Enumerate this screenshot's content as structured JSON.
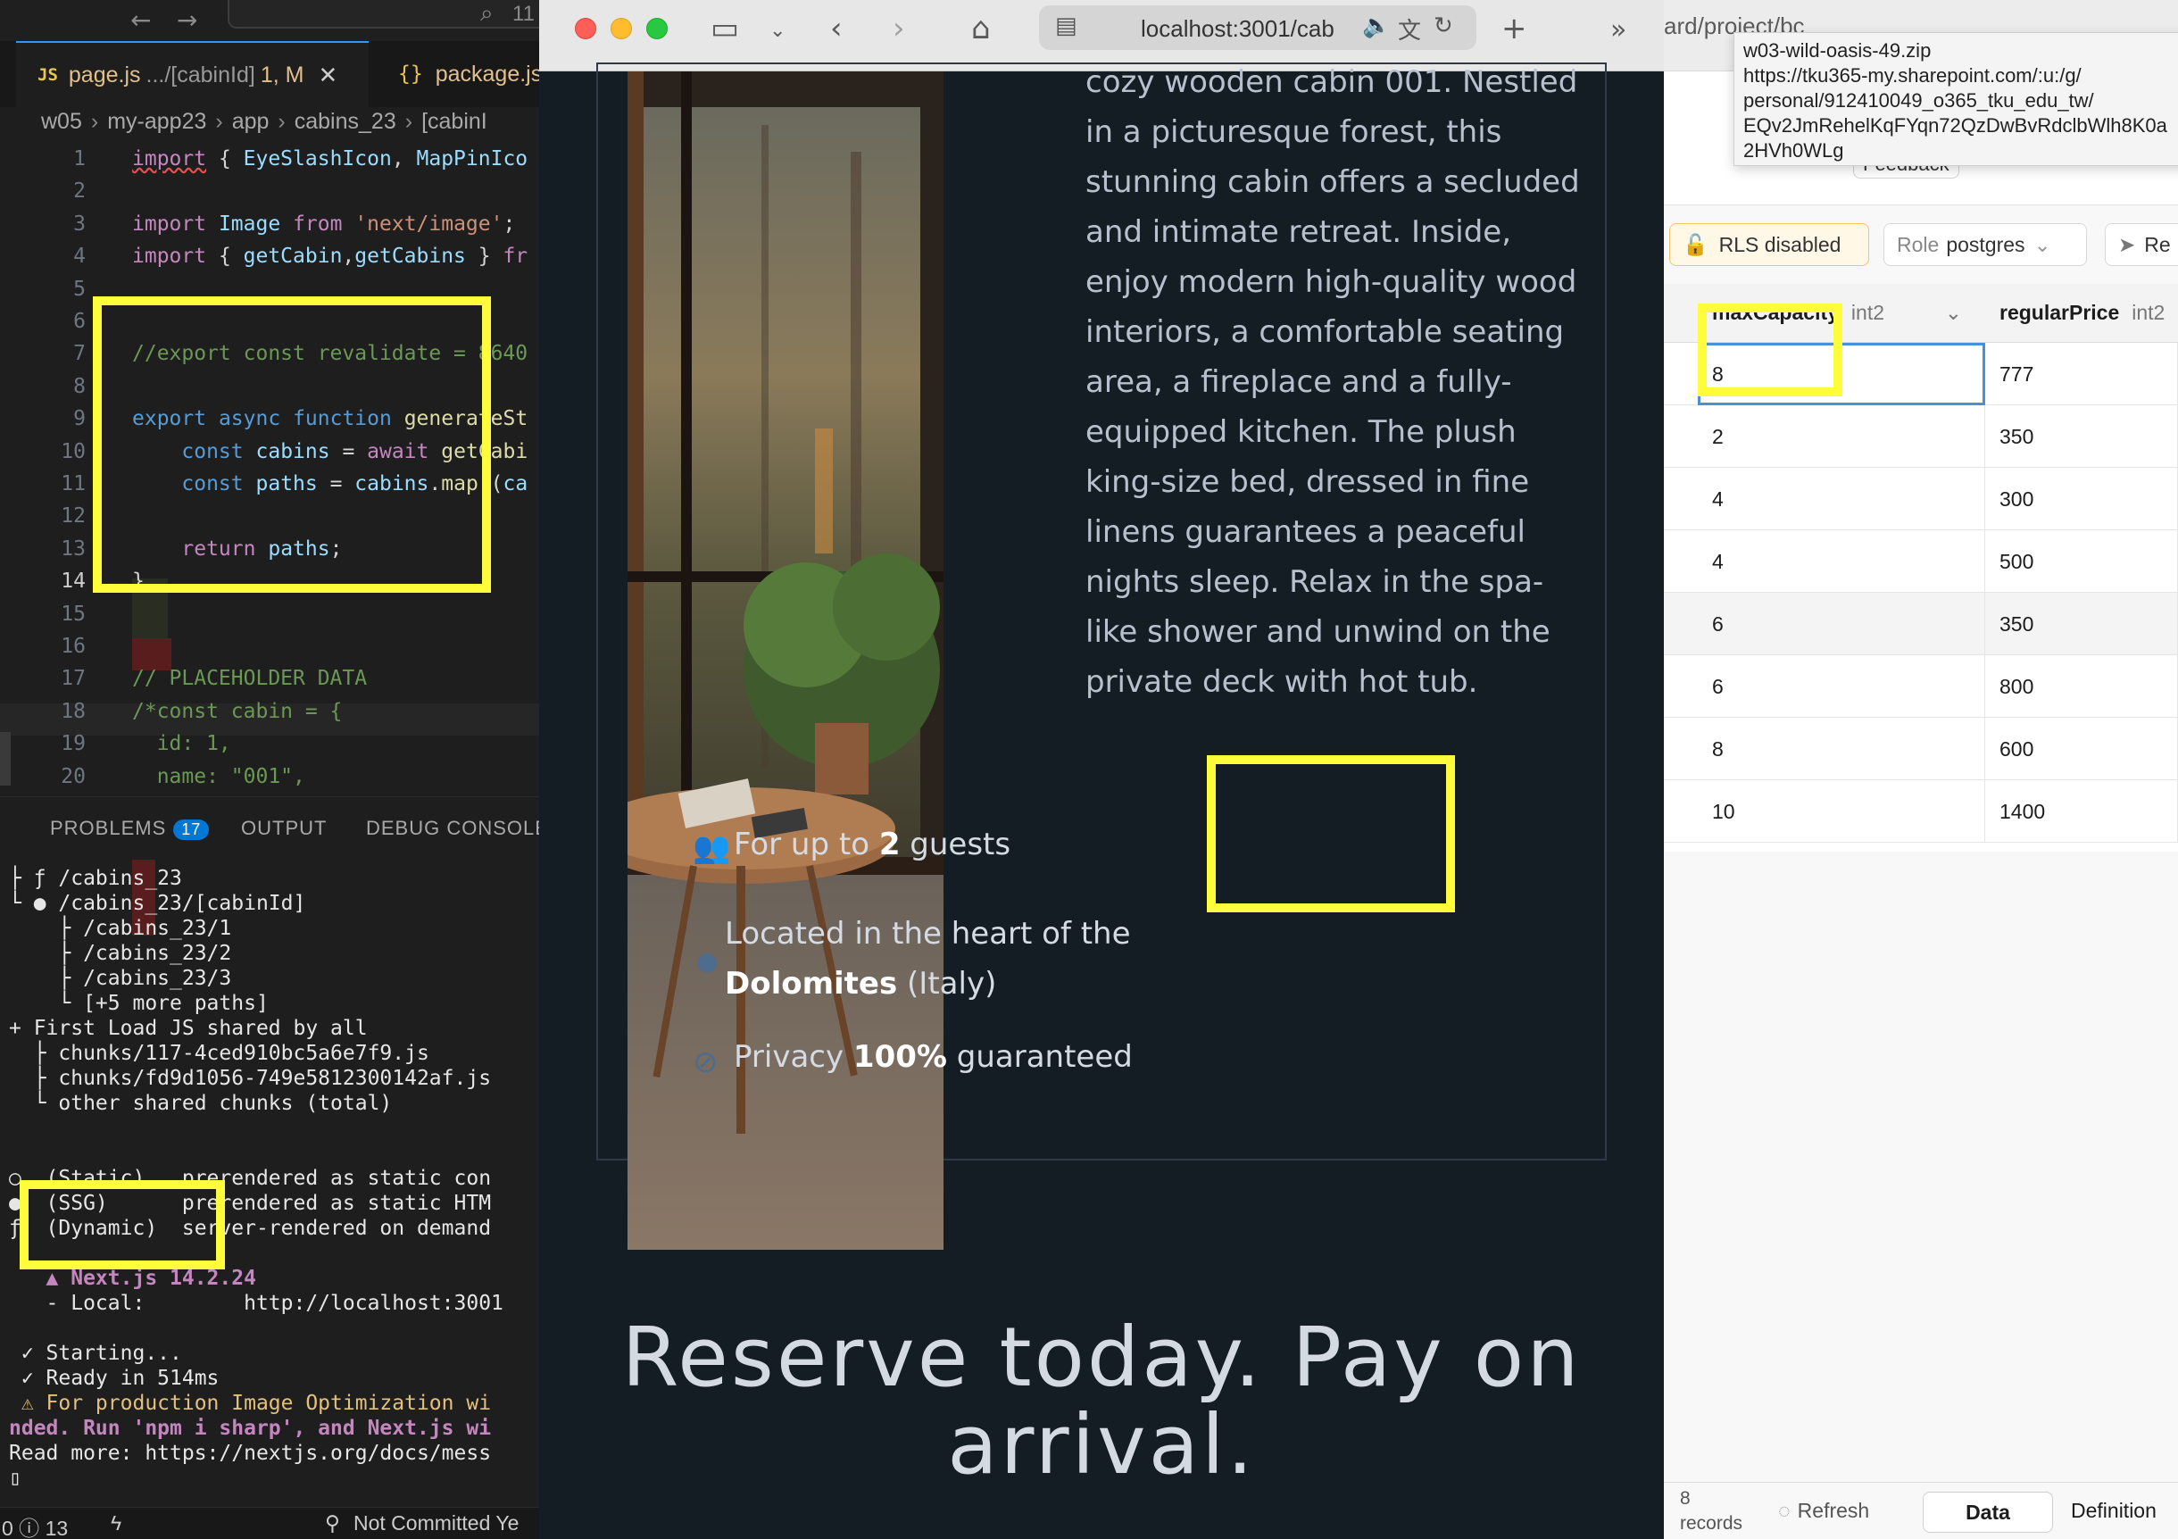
{
  "vscode": {
    "search_text": "11",
    "tabs": [
      {
        "name": "page.js",
        "path": ".../[cabinId]",
        "badge": "1, M"
      },
      {
        "name": "package.js"
      }
    ],
    "breadcrumb": [
      "w05",
      "my-app23",
      "app",
      "cabins_23",
      "[cabinI"
    ],
    "code": [
      {
        "n": "1",
        "t": "import { EyeSlashIcon, MapPinIco"
      },
      {
        "n": "2",
        "t": ""
      },
      {
        "n": "3",
        "t": "import Image from 'next/image';"
      },
      {
        "n": "4",
        "t": "import { getCabin,getCabins } fr"
      },
      {
        "n": "5",
        "t": ""
      },
      {
        "n": "6",
        "t": ""
      },
      {
        "n": "7",
        "t": "//export const revalidate = 8640"
      },
      {
        "n": "8",
        "t": ""
      },
      {
        "n": "9",
        "t": "export async function generateSt"
      },
      {
        "n": "10",
        "t": "const cabins = await getCabi"
      },
      {
        "n": "11",
        "t": "const paths = cabins.map((ca"
      },
      {
        "n": "12",
        "t": ""
      },
      {
        "n": "13",
        "t": "return paths;"
      },
      {
        "n": "14",
        "t": "}"
      },
      {
        "n": "15",
        "t": ""
      },
      {
        "n": "16",
        "t": ""
      },
      {
        "n": "17",
        "t": "// PLACEHOLDER DATA"
      },
      {
        "n": "18",
        "t": "/*const cabin = {"
      },
      {
        "n": "19",
        "t": "id: 1,"
      },
      {
        "n": "20",
        "t": "name: \"001\","
      }
    ],
    "panel_tabs": {
      "problems": "PROBLEMS",
      "problems_count": "17",
      "output": "OUTPUT",
      "debug": "DEBUG CONSOLE"
    },
    "terminal": [
      "├ ƒ /cabins_23",
      "└ ● /cabins_23/[cabinId]",
      "    ├ /cabins_23/1",
      "    ├ /cabins_23/2",
      "    ├ /cabins_23/3",
      "    └ [+5 more paths]",
      "+ First Load JS shared by all",
      "  ├ chunks/117-4ced910bc5a6e7f9.js",
      "  ├ chunks/fd9d1056-749e5812300142af.js",
      "  └ other shared chunks (total)",
      "",
      "",
      "○  (Static)   prerendered as static con",
      "●  (SSG)      prerendered as static HTM",
      "ƒ  (Dynamic)  server-rendered on demand",
      "",
      "   ▲ Next.js 14.2.24",
      "   - Local:        http://localhost:3001",
      "",
      " ✓ Starting...",
      " ✓ Ready in 514ms",
      " ⚠ For production Image Optimization wi",
      "nded. Run 'npm i sharp', and Next.js wi",
      "Read more: https://nextjs.org/docs/mess",
      "▯"
    ],
    "status": {
      "left": "0 ⓘ 13",
      "branch": "Not Committed Ye"
    }
  },
  "safari": {
    "url": "localhost:3001/cab",
    "cabin_description": "cozy wooden cabin 001. Nestled in a picturesque forest, this stunning cabin offers a secluded and intimate retreat. Inside, enjoy modern high-quality wood interiors, a comfortable seating area, a fireplace and a fully-equipped kitchen. The plush king-size bed, dressed in fine linens guarantees a peaceful nights sleep. Relax in the spa-like shower and unwind on the private deck with hot tub.",
    "features": {
      "guests_pre": "For up to ",
      "guests_num": "2",
      "guests_post": " guests",
      "location_pre": "Located in the heart of the",
      "location_bold": "Dolomites",
      "location_post": " (Italy)",
      "privacy_pre": "Privacy ",
      "privacy_bold": "100%",
      "privacy_post": " guaranteed"
    },
    "reserve_title": "Reserve today. Pay on arrival."
  },
  "supabase": {
    "url_fragment": "ard/project/bc",
    "feedback": "Feedback",
    "rls_chip": "RLS disabled",
    "role_chip_label": "Role",
    "role_chip_value": "postgres",
    "re_chip": "Re",
    "columns": [
      {
        "name": "maxCapacity",
        "type": "int2"
      },
      {
        "name": "regularPrice",
        "type": "int2"
      }
    ],
    "rows": [
      {
        "maxCapacity": "8",
        "regularPrice": "777"
      },
      {
        "maxCapacity": "2",
        "regularPrice": "350"
      },
      {
        "maxCapacity": "4",
        "regularPrice": "300"
      },
      {
        "maxCapacity": "4",
        "regularPrice": "500"
      },
      {
        "maxCapacity": "6",
        "regularPrice": "350"
      },
      {
        "maxCapacity": "6",
        "regularPrice": "800"
      },
      {
        "maxCapacity": "8",
        "regularPrice": "600"
      },
      {
        "maxCapacity": "10",
        "regularPrice": "1400"
      }
    ],
    "records_count": "8",
    "records_label": "records",
    "refresh": "Refresh",
    "data_tab": "Data",
    "definition_tab": "Definition"
  },
  "tooltip": {
    "lines": [
      "w03-wild-oasis-49.zip",
      "https://tku365-my.sharepoint.com/:u:/g/",
      "personal/912410049_o365_tku_edu_tw/",
      "EQv2JmRehelKqFYqn72QzDwBvRdclbWlh8K0a",
      "2HVh0WLg"
    ]
  },
  "colors": {
    "annotation": "#fffc3b",
    "vscode_bg": "#1e1e1e",
    "page_bg": "#141c24",
    "accent_blue": "#3794ff"
  }
}
